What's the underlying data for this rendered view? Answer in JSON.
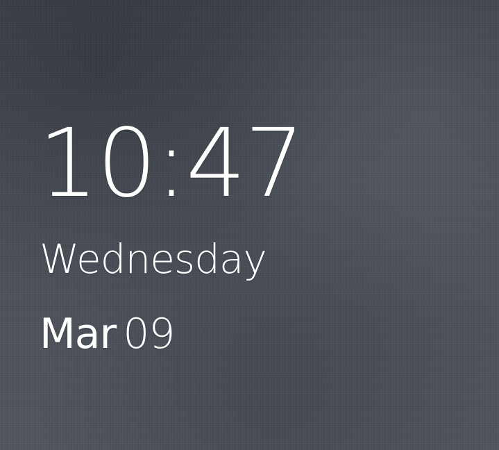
{
  "clock": {
    "time": "10:47",
    "weekday": "Wednesday",
    "month": "Mar",
    "day": "09"
  }
}
